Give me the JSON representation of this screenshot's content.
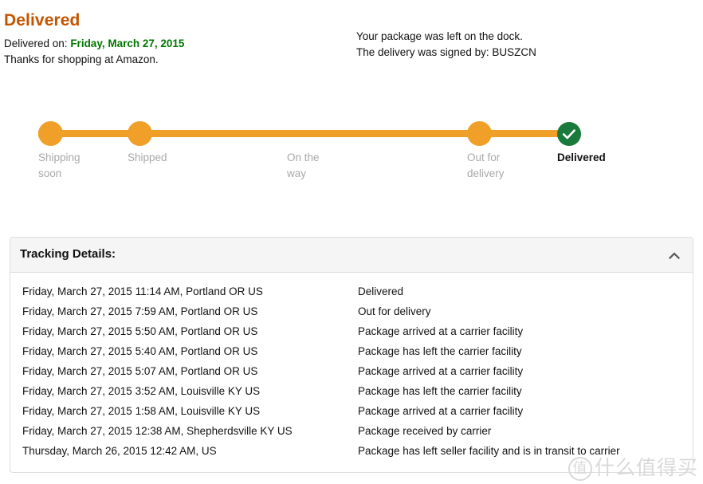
{
  "summary": {
    "status_heading": "Delivered",
    "delivered_on_label": "Delivered on:",
    "delivered_on_date": "Friday, March 27, 2015",
    "thanks": "Thanks for shopping at Amazon.",
    "note_line_1": "Your package was left on the dock.",
    "note_line_2": "The delivery was signed by: BUSZCN",
    "heading_color": "#c45500",
    "date_color": "#007600"
  },
  "tracker": {
    "bar_color": "#f0a029",
    "complete_color": "#1a7a3c",
    "pending_label_color": "#a8a8a8",
    "steps": [
      {
        "label": "Shipping soon",
        "state": "done",
        "marker": "dot"
      },
      {
        "label": "Shipped",
        "state": "done",
        "marker": "dot"
      },
      {
        "label": "On the way",
        "state": "pending",
        "marker": "none"
      },
      {
        "label": "Out for delivery",
        "state": "done",
        "marker": "dot"
      },
      {
        "label": "Delivered",
        "state": "current",
        "marker": "check"
      }
    ]
  },
  "details": {
    "title": "Tracking Details:",
    "collapse_icon": "chevron-up-icon",
    "rows": [
      {
        "when": "Friday, March 27, 2015 11:14 AM, Portland OR US",
        "what": "Delivered"
      },
      {
        "when": "Friday, March 27, 2015 7:59 AM, Portland OR US",
        "what": "Out for delivery"
      },
      {
        "when": "Friday, March 27, 2015 5:50 AM, Portland OR US",
        "what": "Package arrived at a carrier facility"
      },
      {
        "when": "Friday, March 27, 2015 5:40 AM, Portland OR US",
        "what": "Package has left the carrier facility"
      },
      {
        "when": "Friday, March 27, 2015 5:07 AM, Portland OR US",
        "what": "Package arrived at a carrier facility"
      },
      {
        "when": "Friday, March 27, 2015 3:52 AM, Louisville KY US",
        "what": "Package has left the carrier facility"
      },
      {
        "when": "Friday, March 27, 2015 1:58 AM, Louisville KY US",
        "what": "Package arrived at a carrier facility"
      },
      {
        "when": "Friday, March 27, 2015 12:38 AM, Shepherdsville KY US",
        "what": "Package received by carrier"
      },
      {
        "when": "Thursday, March 26, 2015 12:42 AM, US",
        "what": "Package has left seller facility and is in transit to carrier"
      }
    ]
  },
  "watermark": {
    "mark": "值",
    "text": "什么值得买"
  }
}
